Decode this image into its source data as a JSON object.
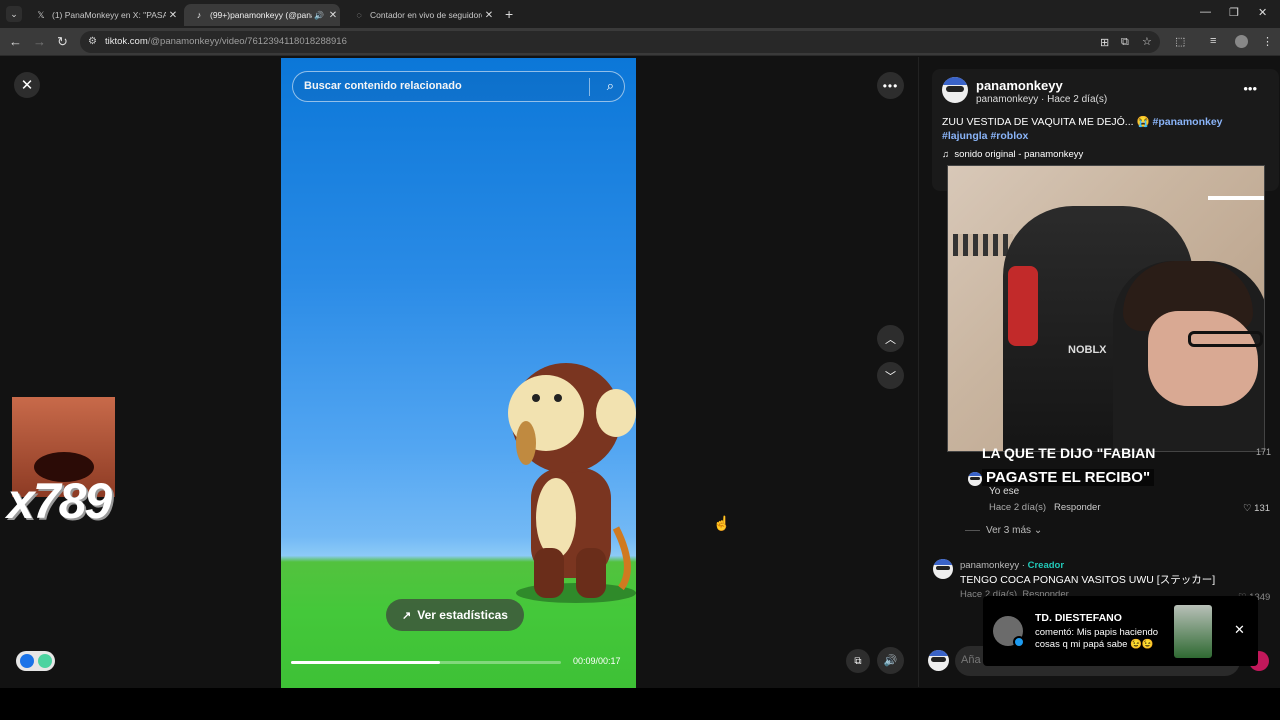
{
  "browser": {
    "tabs": [
      {
        "title": "(1) PanaMonkeyy en X: \"PASAD",
        "icon": "x-logo-icon",
        "active": false
      },
      {
        "title": "(99+)panamonkeyy (@pana",
        "icon": "tiktok-icon",
        "active": true
      },
      {
        "title": "Contador en vivo de seguidore",
        "icon": "globe-icon",
        "active": false
      }
    ],
    "url_host": "tiktok.com",
    "url_path": "/@panamonkeyy/video/7612394118018288916"
  },
  "video": {
    "search_placeholder": "Buscar contenido relacionado",
    "stats_label": "Ver estadísticas",
    "time": "00:09/00:17",
    "progress": 0.55
  },
  "overlay": {
    "counter": "x789"
  },
  "post": {
    "username": "panamonkeyy",
    "subline": "panamonkeyy · Hace 2 día(s)",
    "description": "ZUU VESTIDA DE VAQUITA ME DEJÓ... 😭",
    "hashtags": [
      "#panamonkey",
      "#lajungla",
      "#roblox"
    ],
    "music": "sonido original - panamonkeyy"
  },
  "webcam": {
    "chair_logo": "NOBLX"
  },
  "comments": {
    "caption_line1": "LA QUE TE DIJO \"FABIAN",
    "caption_line2": "PAGASTE EL RECIBO\"",
    "like_top": "171",
    "reply_text": "Yo ese",
    "reply_time": "Hace 2 día(s)",
    "reply_label": "Responder",
    "reply_likes": "131",
    "see_more": "Ver 3 más",
    "c2_user": "panamonkeyy",
    "c2_badge": "Creador",
    "c2_text": "TENGO COCA PONGAN VASITOS UWU [ステッカー]",
    "c2_time": "Hace 2 día(s)",
    "c2_reply": "Responder",
    "c2_likes": "1349"
  },
  "notification": {
    "title": "TD. DIESTEFANO",
    "body": "comentó: Mis papis haciendo cosas q mi papá sabe 😉😉"
  },
  "composer": {
    "placeholder": "Aña"
  }
}
